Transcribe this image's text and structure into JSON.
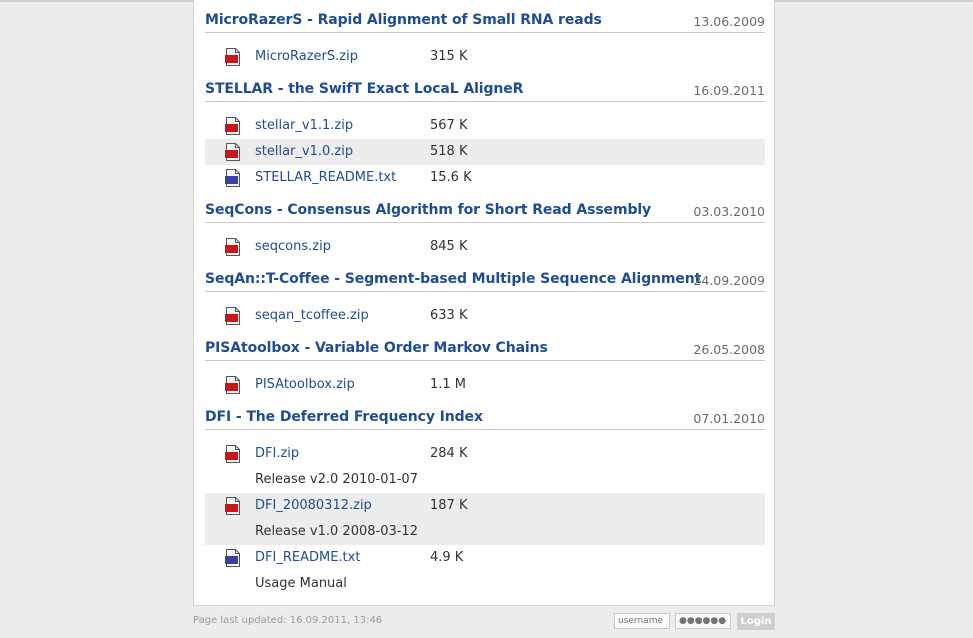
{
  "sections": [
    {
      "title": "MicroRazerS - Rapid Alignment of Small RNA reads",
      "date": "13.06.2009",
      "files": [
        {
          "icon": "zip-file-icon",
          "name": "MicroRazerS.zip",
          "size": "315 K",
          "note": ""
        }
      ]
    },
    {
      "title": "STELLAR - the SwifT Exact LocaL AligneR",
      "date": "16.09.2011",
      "files": [
        {
          "icon": "zip-file-icon",
          "name": "stellar_v1.1.zip",
          "size": "567 K",
          "note": ""
        },
        {
          "icon": "zip-file-icon",
          "name": "stellar_v1.0.zip",
          "size": "518 K",
          "note": ""
        },
        {
          "icon": "txt-file-icon",
          "name": "STELLAR_README.txt",
          "size": "15.6 K",
          "note": ""
        }
      ]
    },
    {
      "title": "SeqCons - Consensus Algorithm for Short Read Assembly",
      "date": "03.03.2010",
      "files": [
        {
          "icon": "zip-file-icon",
          "name": "seqcons.zip",
          "size": "845 K",
          "note": ""
        }
      ]
    },
    {
      "title": "SeqAn::T-Coffee - Segment-based Multiple Sequence Alignment",
      "date": "24.09.2009",
      "files": [
        {
          "icon": "zip-file-icon",
          "name": "seqan_tcoffee.zip",
          "size": "633 K",
          "note": ""
        }
      ]
    },
    {
      "title": "PISAtoolbox - Variable Order Markov Chains",
      "date": "26.05.2008",
      "files": [
        {
          "icon": "zip-file-icon",
          "name": "PISAtoolbox.zip",
          "size": "1.1 M",
          "note": ""
        }
      ]
    },
    {
      "title": "DFI - The Deferred Frequency Index",
      "date": "07.01.2010",
      "files": [
        {
          "icon": "zip-file-icon",
          "name": "DFI.zip",
          "size": "284 K",
          "note": "Release v2.0 2010-01-07"
        },
        {
          "icon": "zip-file-icon",
          "name": "DFI_20080312.zip",
          "size": "187 K",
          "note": "Release v1.0 2008-03-12"
        },
        {
          "icon": "txt-file-icon",
          "name": "DFI_README.txt",
          "size": "4.9 K",
          "note": "Usage Manual"
        }
      ]
    }
  ],
  "footer": {
    "last_updated": "Page last updated: 16.09.2011, 13:46",
    "username_placeholder": "username",
    "password_placeholder": "●●●●●●●●",
    "login_label": "Login"
  },
  "colors": {
    "link": "#1f4d93",
    "zip_icon": "#c8161d",
    "txt_icon": "#3b3fa0",
    "alt_row": "#ededed"
  }
}
